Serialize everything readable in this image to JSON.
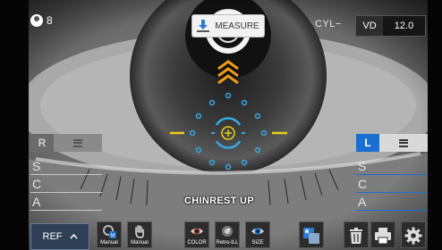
{
  "top": {
    "patient_count": "8",
    "measure_label": "MEASURE",
    "cyl_label": "CYL−",
    "vd_label": "VD",
    "vd_value": "12.0"
  },
  "left_panel": {
    "eye_label": "R",
    "rows": [
      "S",
      "C",
      "A"
    ]
  },
  "right_panel": {
    "eye_label": "L",
    "rows": [
      "S",
      "C",
      "A"
    ]
  },
  "status": {
    "message": "CHINREST UP"
  },
  "toolbar": {
    "ref_label": "REF",
    "manual1": "Manual",
    "manual2": "Manual",
    "color": "COLOR",
    "retro": "Retro-ILL",
    "size": "SIZE"
  },
  "colors": {
    "accent": "#1b6fd0",
    "target_blue": "#3aa6e0",
    "arrow_orange": "#f29a16",
    "line_yellow": "#e8d21a"
  },
  "icons": [
    "user-icon",
    "download-icon",
    "chevron-up-icon",
    "manual-icon",
    "hand-icon",
    "eye-icon",
    "retro-icon",
    "size-icon",
    "compare-icon",
    "trash-icon",
    "print-icon",
    "gear-icon",
    "list-icon"
  ]
}
